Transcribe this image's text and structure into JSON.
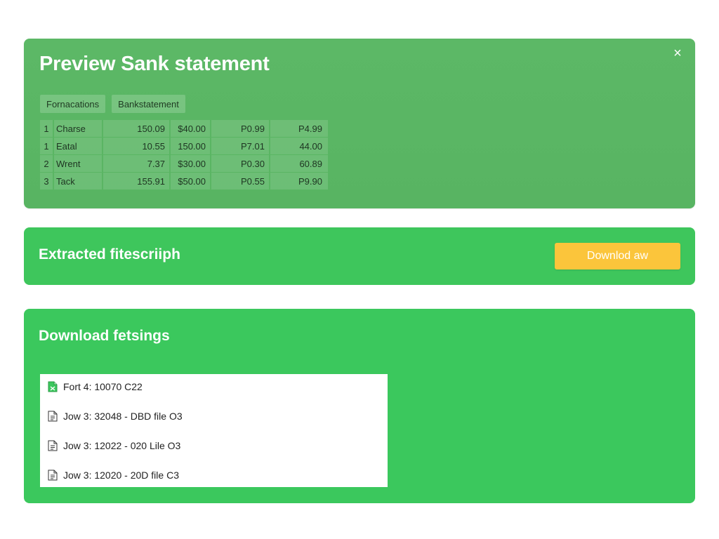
{
  "preview": {
    "title": "Preview Sank statement",
    "close_symbol": "×",
    "tabs": [
      {
        "label": "Fornacations"
      },
      {
        "label": "Bankstatement"
      }
    ],
    "rows": [
      [
        "1",
        "Charse",
        "150.09",
        "$40.00",
        "P0.99",
        "P4.99"
      ],
      [
        "1",
        "Eatal",
        "10.55",
        "150.00",
        "P7.01",
        "44.00"
      ],
      [
        "2",
        "Wrent",
        "7.37",
        "$30.00",
        "P0.30",
        "60.89"
      ],
      [
        "3",
        "Tack",
        "155.91",
        "$50.00",
        "P0.55",
        "P9.90"
      ]
    ]
  },
  "extracted": {
    "title": "Extracted fitescriiph",
    "download_label": "Downlod aw",
    "accent_color": "#fbc53b"
  },
  "downloads": {
    "title": "Download fetsings",
    "files": [
      {
        "label": "Fort 4: 10070 C22",
        "icon": "spreadsheet-file-icon"
      },
      {
        "label": "Jow 3: 32048 - DBD file O3",
        "icon": "document-file-icon"
      },
      {
        "label": "Jow 3: 12022 - 020 Lile O3",
        "icon": "document-file-icon"
      },
      {
        "label": "Jow 3: 12020 - 20D file C3",
        "icon": "document-file-icon"
      }
    ]
  }
}
